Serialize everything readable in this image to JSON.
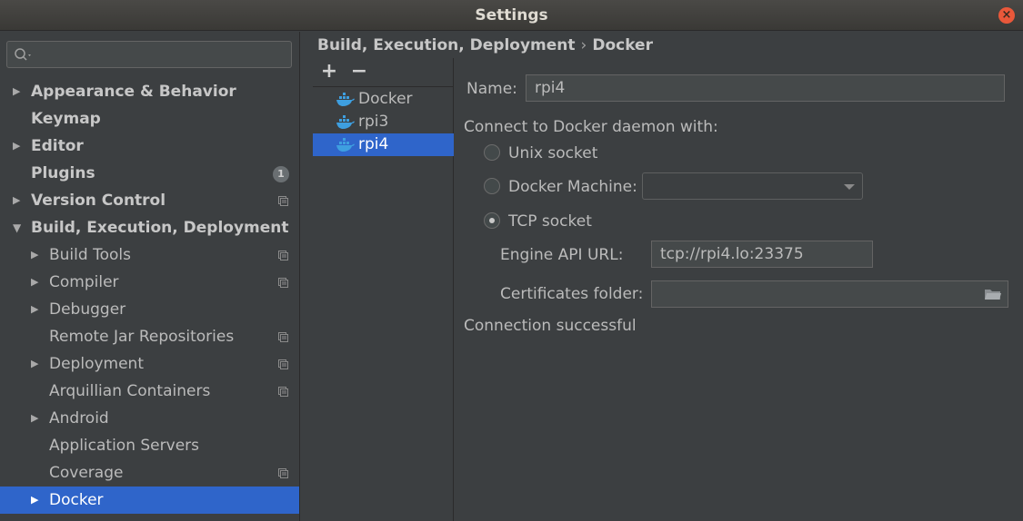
{
  "window": {
    "title": "Settings",
    "close_glyph": "×"
  },
  "sidebar": {
    "search_placeholder": "",
    "items": [
      {
        "label": "Appearance & Behavior",
        "bold": true,
        "arrow": "right"
      },
      {
        "label": "Keymap",
        "bold": true,
        "arrow": "none"
      },
      {
        "label": "Editor",
        "bold": true,
        "arrow": "right"
      },
      {
        "label": "Plugins",
        "bold": true,
        "arrow": "none",
        "badge": "1"
      },
      {
        "label": "Version Control",
        "bold": true,
        "arrow": "right",
        "project_icon": true
      },
      {
        "label": "Build, Execution, Deployment",
        "bold": true,
        "arrow": "down"
      },
      {
        "label": "Build Tools",
        "arrow": "right",
        "project_icon": true
      },
      {
        "label": "Compiler",
        "arrow": "right",
        "project_icon": true
      },
      {
        "label": "Debugger",
        "arrow": "right"
      },
      {
        "label": "Remote Jar Repositories",
        "arrow": "none",
        "project_icon": true
      },
      {
        "label": "Deployment",
        "arrow": "right",
        "project_icon": true
      },
      {
        "label": "Arquillian Containers",
        "arrow": "none",
        "project_icon": true
      },
      {
        "label": "Android",
        "arrow": "right"
      },
      {
        "label": "Application Servers",
        "arrow": "none"
      },
      {
        "label": "Coverage",
        "arrow": "none",
        "project_icon": true
      },
      {
        "label": "Docker",
        "arrow": "right",
        "selected": true
      }
    ]
  },
  "breadcrumb": {
    "parent": "Build, Execution, Deployment",
    "separator": "›",
    "current": "Docker"
  },
  "docker_list": {
    "add_label": "+",
    "remove_label": "−",
    "items": [
      {
        "label": "Docker",
        "selected": false
      },
      {
        "label": "rpi3",
        "selected": false
      },
      {
        "label": "rpi4",
        "selected": true
      }
    ]
  },
  "form": {
    "name_label": "Name:",
    "name_value": "rpi4",
    "connect_label": "Connect to Docker daemon with:",
    "unix_socket_label": "Unix socket",
    "docker_machine_label": "Docker Machine:",
    "docker_machine_value": "",
    "tcp_socket_label": "TCP socket",
    "selected_option": "tcp",
    "engine_api_label": "Engine API URL:",
    "engine_api_value": "tcp://rpi4.lo:23375",
    "certs_label": "Certificates folder:",
    "certs_value": "",
    "status": "Connection successful"
  },
  "colors": {
    "selection": "#2f65ca",
    "background": "#3c3f41",
    "close": "#e9583a"
  }
}
